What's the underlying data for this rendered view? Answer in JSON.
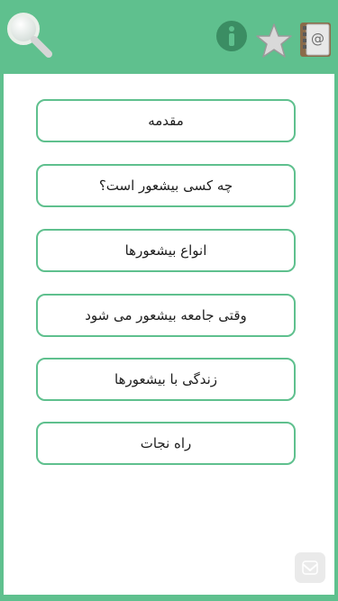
{
  "toolbar": {
    "search_icon": "search-icon",
    "info_icon": "info-icon",
    "star_icon": "star-icon",
    "contact_icon": "contact-book-icon"
  },
  "menu": {
    "items": [
      {
        "label": "مقدمه"
      },
      {
        "label": "چه کسی بیشعور است؟"
      },
      {
        "label": "انواع بیشعورها"
      },
      {
        "label": "وقتی جامعه بیشعور می شود"
      },
      {
        "label": "زندگی با بیشعورها"
      },
      {
        "label": "راه نجات"
      }
    ]
  },
  "colors": {
    "accent": "#5fc08e",
    "icon_dark": "#3b8d63",
    "surface": "#ffffff",
    "text": "#1d1d1d"
  }
}
